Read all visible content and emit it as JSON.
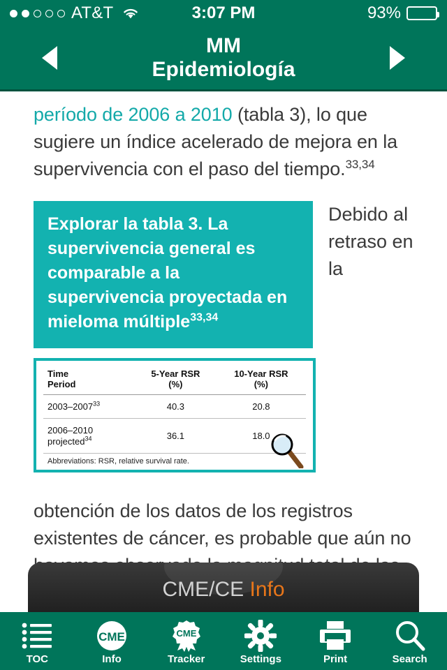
{
  "status_bar": {
    "signal_dots_filled": 2,
    "signal_dots_total": 5,
    "carrier": "AT&T",
    "wifi_icon": "wifi-icon",
    "time": "3:07 PM",
    "battery_percent": "93%",
    "battery_level": 93
  },
  "header": {
    "prev_icon": "chevron-left-icon",
    "next_icon": "chevron-right-icon",
    "title": "MM",
    "subtitle": "Epidemiología",
    "background_color": "#00755A"
  },
  "content": {
    "paragraph_1": {
      "link_text": "período de 2006 a 2010",
      "rest_text": " (tabla 3), lo que sugiere un índice acelerado de mejora en la supervivencia con el paso del tiempo.",
      "superscript": "33,34",
      "link_color": "#13A9A9"
    },
    "callout": {
      "text": "Explorar la tabla 3. La supervivencia general es comparable a la supervivencia proyectada en mieloma múltiple",
      "superscript": "33,34",
      "background_color": "#13B2B0",
      "text_color": "#FFFFFF"
    },
    "side_text": "Debido al retraso en la",
    "table_card": {
      "border_color": "#13B2B0",
      "magnifier_icon": "magnifying-glass-icon",
      "columns": [
        "Time Period",
        "5-Year RSR (%)",
        "10-Year RSR (%)"
      ],
      "columns_split": [
        {
          "line1": "Time",
          "line2": "Period"
        },
        {
          "line1": "5-Year RSR",
          "line2": "(%)"
        },
        {
          "line1": "10-Year RSR",
          "line2": "(%)"
        }
      ],
      "rows": [
        {
          "period": "2003–2007",
          "period_sup": "33",
          "period_line2": "",
          "five_year": "40.3",
          "ten_year": "20.8"
        },
        {
          "period": "2006–2010",
          "period_sup": "",
          "period_line2": "projected",
          "period_line2_sup": "34",
          "five_year": "36.1",
          "ten_year": "18.0"
        }
      ],
      "note": "Abbreviations: RSR, relative survival rate."
    },
    "paragraph_2": "obtención de los datos de los registros existentes de cáncer, es probable que aún no hayamos observado la magnitud total de las mejoras en los resultados"
  },
  "cme_bar": {
    "label_primary": "CME/CE",
    "label_accent": "Info",
    "accent_color": "#E8761A"
  },
  "toolbar": {
    "background_color": "#00755A",
    "items": [
      {
        "label": "TOC",
        "icon": "list-icon"
      },
      {
        "label": "Info",
        "icon": "cme-circle-icon"
      },
      {
        "label": "Tracker",
        "icon": "cme-badge-icon"
      },
      {
        "label": "Settings",
        "icon": "gear-icon"
      },
      {
        "label": "Print",
        "icon": "printer-icon"
      },
      {
        "label": "Search",
        "icon": "search-icon"
      }
    ]
  }
}
